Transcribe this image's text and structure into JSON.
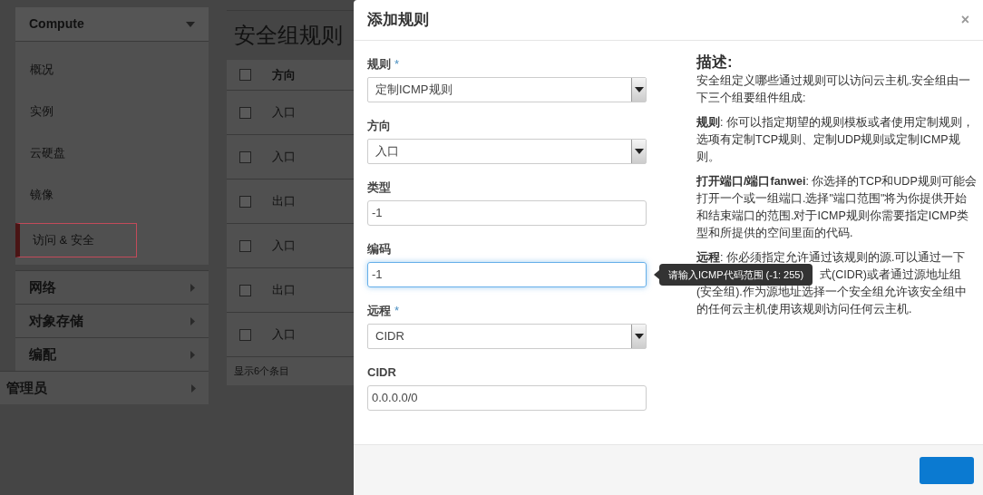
{
  "sidebar": {
    "header": "Compute",
    "items": [
      {
        "label": "概况",
        "selected": false
      },
      {
        "label": "实例",
        "selected": false
      },
      {
        "label": "云硬盘",
        "selected": false
      },
      {
        "label": "镜像",
        "selected": false
      },
      {
        "label": "访问 & 安全",
        "selected": true
      }
    ],
    "sections": [
      {
        "label": "网络",
        "kind": "group"
      },
      {
        "label": "对象存储",
        "kind": "group"
      },
      {
        "label": "编配",
        "kind": "group"
      },
      {
        "label": "管理员",
        "kind": "top"
      }
    ]
  },
  "page": {
    "title": "安全组规则",
    "table": {
      "column": "方向",
      "header_checked": false,
      "rows": [
        {
          "direction": "入口",
          "checked": false
        },
        {
          "direction": "入口",
          "checked": false
        },
        {
          "direction": "出口",
          "checked": false
        },
        {
          "direction": "入口",
          "checked": false
        },
        {
          "direction": "出口",
          "checked": false
        },
        {
          "direction": "入口",
          "checked": false
        }
      ],
      "footer": "显示6个条目"
    }
  },
  "dialog": {
    "title": "添加规则",
    "close": "×",
    "fields": [
      {
        "label": "规则",
        "required_mark": "*",
        "kind": "select",
        "value": "定制ICMP规则",
        "focused": false
      },
      {
        "label": "方向",
        "kind": "select",
        "value": "入口",
        "focused": false
      },
      {
        "label": "类型",
        "kind": "text",
        "value": "-1",
        "focused": false
      },
      {
        "label": "编码",
        "kind": "text",
        "value": "-1",
        "focused": true
      },
      {
        "label": "远程",
        "required_mark": "*",
        "kind": "select",
        "value": "CIDR",
        "focused": false
      },
      {
        "label": "CIDR",
        "kind": "text",
        "value": "0.0.0.0/0",
        "focused": false
      }
    ],
    "tooltip": "请输入ICMP代码范围 (-1: 255)",
    "description": {
      "title": "描述:",
      "intro": "安全组定义哪些通过规则可以访问云主机.安全组由一下三个组要组件组成:",
      "paragraphs": [
        {
          "term": "规则",
          "text": ": 你可以指定期望的规则模板或者使用定制规则，选项有定制TCP规则、定制UDP规则或定制ICMP规则。"
        },
        {
          "term": "打开端口/端口fanwei",
          "text": ": 你选择的TCP和UDP规则可能会打开一个或一组端口.选择\"端口范围\"将为你提供开始和结束端口的范围.对于ICMP规则你需要指定ICMP类型和所提供的空间里面的代码."
        }
      ],
      "remote": {
        "term": "远程",
        "text_before": ": 你必须指定允许通过该规则的源.可以通过一下",
        "text_after": "式(CIDR)或者通过源地址组",
        "text_rest": "(安全组).作为源地址选择一个安全组允许该安全组中的任何云主机使用该规则访问任何云主机."
      }
    }
  }
}
